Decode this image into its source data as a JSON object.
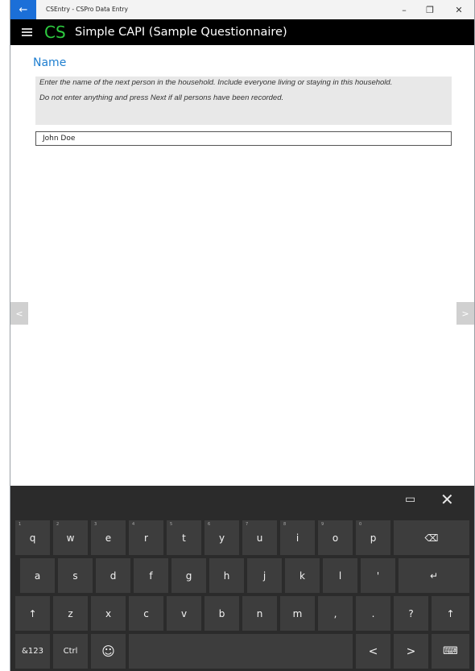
{
  "window": {
    "title": "CSEntry - CSPro Data Entry",
    "back_icon": "←",
    "minimize": "–",
    "restore": "❐",
    "close": "✕",
    "accent_color": "#1b6fd8"
  },
  "appbar": {
    "logo": "CS",
    "title": "Simple CAPI (Sample Questionnaire)",
    "logo_color": "#2ecc40"
  },
  "form": {
    "field_label": "Name",
    "question_line1": "Enter the name of the next person in the household. Include everyone living or staying in this household.",
    "question_line2": "Do not enter anything and press Next if all persons have been recorded.",
    "answer_value": "John Doe",
    "prev_arrow": "<",
    "next_arrow": ">"
  },
  "keyboard": {
    "layout_icon": "▭",
    "close_icon": "✕",
    "row1": [
      {
        "label": "q",
        "num": "1"
      },
      {
        "label": "w",
        "num": "2"
      },
      {
        "label": "e",
        "num": "3"
      },
      {
        "label": "r",
        "num": "4"
      },
      {
        "label": "t",
        "num": "5"
      },
      {
        "label": "y",
        "num": "6"
      },
      {
        "label": "u",
        "num": "7"
      },
      {
        "label": "i",
        "num": "8"
      },
      {
        "label": "o",
        "num": "9"
      },
      {
        "label": "p",
        "num": "0"
      }
    ],
    "backspace": "⌫",
    "row2": [
      "a",
      "s",
      "d",
      "f",
      "g",
      "h",
      "j",
      "k",
      "l",
      "'"
    ],
    "enter": "↵",
    "shift": "↑",
    "row3": [
      "z",
      "x",
      "c",
      "v",
      "b",
      "n",
      "m",
      ",",
      ".",
      "?"
    ],
    "symbols": "&123",
    "ctrl": "Ctrl",
    "emoji": "☺",
    "left": "<",
    "right": ">",
    "kbd_icon": "⌨"
  }
}
